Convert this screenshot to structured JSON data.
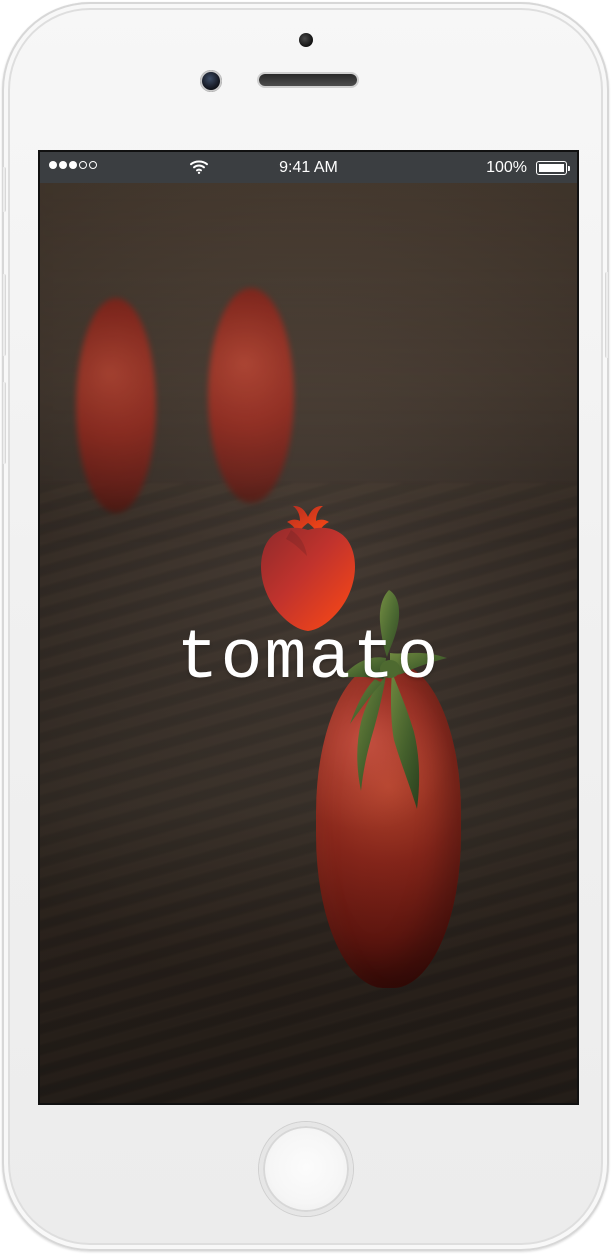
{
  "status_bar": {
    "signal": "signal-icon",
    "wifi": "wifi-icon",
    "time": "9:41 AM",
    "battery_percent": "100%",
    "battery_icon": "battery-icon"
  },
  "splash": {
    "brand_name": "tomato",
    "logo_icon": "tomato-logo-icon",
    "background": "tomato-photo-background"
  },
  "device": {
    "home_button": "home-button",
    "camera": "front-camera",
    "speaker": "earpiece-speaker"
  },
  "colors": {
    "status_bar_bg": "#3b3e41",
    "logo_red": "#ff4a13",
    "logo_dark": "#9f2d26",
    "text_white": "#ffffff"
  }
}
